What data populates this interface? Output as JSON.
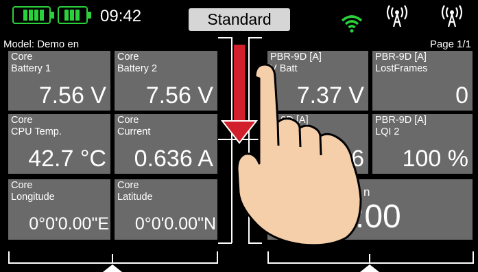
{
  "status": {
    "clock": "09:42",
    "mode": "Standard",
    "colors": {
      "battery": "#2bd13a",
      "wifi": "#2bd13a"
    }
  },
  "header": {
    "model": "Model: Demo en",
    "page": "Page  1/1"
  },
  "tiles": [
    {
      "label1": "Core",
      "label2": "Battery 1",
      "value": "7.56 V"
    },
    {
      "label1": "Core",
      "label2": "Battery 2",
      "value": "7.56 V"
    },
    {
      "label1": "Core",
      "label2": "CPU Temp.",
      "value": "42.7 °C"
    },
    {
      "label1": "Core",
      "label2": "Current",
      "value": "0.636 A"
    },
    {
      "label1": "Core",
      "label2": "Longitude",
      "value": "0°0'0.00\"E"
    },
    {
      "label1": "Core",
      "label2": "Latitude",
      "value": "0°0'0.00\"N"
    },
    {
      "label1": "PBR-9D [A]",
      "label2": "V Batt",
      "value": "7.37 V"
    },
    {
      "label1": "PBR-9D [A]",
      "label2": "LostFrames",
      "value": "0"
    },
    {
      "label1": "R-9D [A]",
      "label2": "",
      "value": "6"
    },
    {
      "label1": "PBR-9D [A]",
      "label2": "LQI 2",
      "value": "100 %"
    },
    {
      "label1": "",
      "label2": "n",
      "value": ":00"
    }
  ],
  "icons": {
    "battery": "battery-icon",
    "wifi": "wifi-icon",
    "antenna": "antenna-icon",
    "arrow": "swipe-down-arrow",
    "hand": "hand-gesture-icon"
  }
}
